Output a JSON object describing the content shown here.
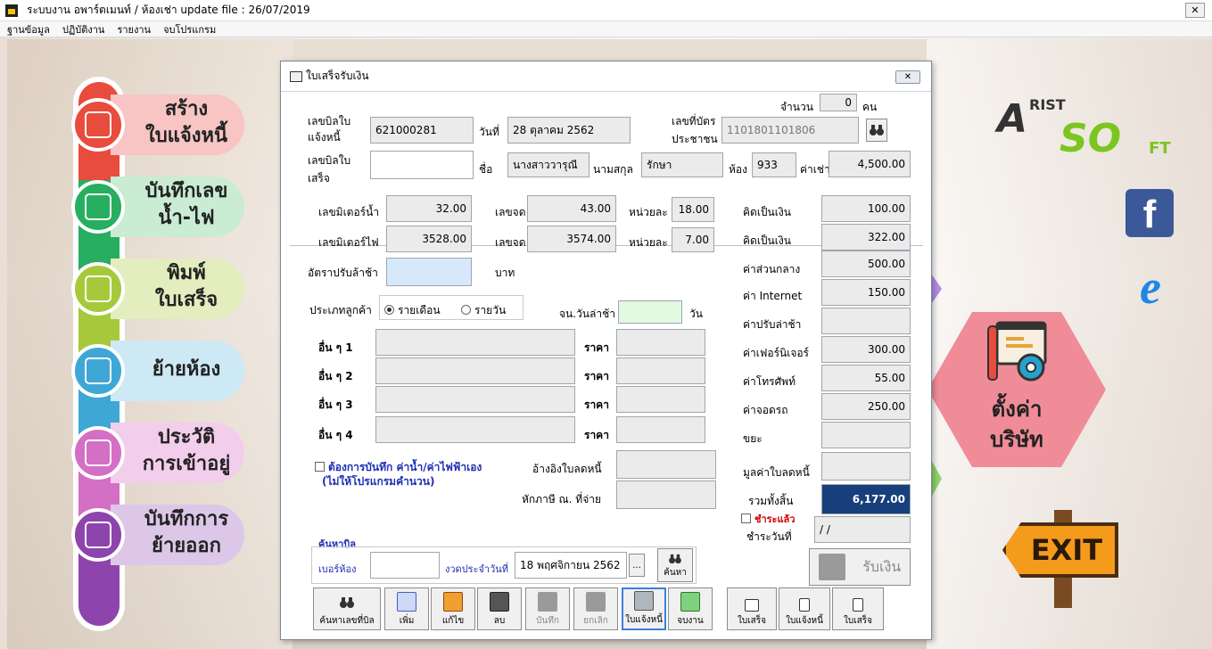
{
  "window": {
    "title": "ระบบงาน อพาร์ตเมนท์ / ห้องเช่า update file : 26/07/2019",
    "close_label": "✕"
  },
  "menu": [
    "ฐานข้อมูล",
    "ปฏิบัติงาน",
    "รายงาน",
    "จบโปรแกรม"
  ],
  "left_menu": [
    {
      "label1": "สร้าง",
      "label2": "ใบแจ้งหนี้",
      "color": "#e74c3c",
      "pill": "#f8c4c4"
    },
    {
      "label1": "บันทึกเลข",
      "label2": "น้ำ-ไฟ",
      "color": "#27ae60",
      "pill": "#c9ecd3"
    },
    {
      "label1": "พิมพ์",
      "label2": "ใบเสร็จ",
      "color": "#a6c93b",
      "pill": "#e3edbd"
    },
    {
      "label1": "ย้ายห้อง",
      "label2": "",
      "color": "#3fa7d6",
      "pill": "#cde9f5"
    },
    {
      "label1": "ประวัติ",
      "label2": "การเข้าอยู่",
      "color": "#d36fc4",
      "pill": "#f3cdec"
    },
    {
      "label1": "บันทึกการ",
      "label2": "ย้ายออก",
      "color": "#8e44ad",
      "pill": "#dcc7e8"
    }
  ],
  "right": {
    "settings_line1": "ตั้งค่า",
    "settings_line2": "บริษัท",
    "exit_label": "EXIT",
    "fb": "f",
    "ie": "e"
  },
  "logo": {
    "a": "A",
    "rist": "RIST",
    "soft": "SO",
    "ft": "FT"
  },
  "dialog": {
    "title": "ใบเสร็จรับเงิน",
    "close": "✕",
    "count_label": "จำนวน",
    "count_value": "0",
    "count_unit": "คน",
    "invoice_no_label1": "เลขบิลใบ",
    "invoice_no_label2": "แจ้งหนี้",
    "invoice_no": "621000281",
    "date_label": "วันที่",
    "date_value": "28 ตุลาคม 2562",
    "id_card_label1": "เลขที่บัตร",
    "id_card_label2": "ประชาชน",
    "id_card": "1101801101806",
    "receipt_no_label1": "เลขบิลใบ",
    "receipt_no_label2": "เสร็จ",
    "receipt_no": "",
    "first_name_label": "ชื่อ",
    "first_name": "นางสาววารุณี",
    "last_name_label": "นามสกุล",
    "last_name": "รักษา",
    "room_label": "ห้อง",
    "room": "933",
    "rent_label": "ค่าเช่า",
    "rent": "4,500.00",
    "water_meter_label": "เลขมิเตอร์น้ำ",
    "water_meter": "32.00",
    "water_read_label": "เลขจด",
    "water_read": "43.00",
    "water_unit_label": "หน่วยละ",
    "water_unit": "18.00",
    "water_amount_label": "คิดเป็นเงิน",
    "water_amount": "100.00",
    "elec_meter_label": "เลขมิเตอร์ไฟ",
    "elec_meter": "3528.00",
    "elec_read_label": "เลขจด",
    "elec_read": "3574.00",
    "elec_unit_label": "หน่วยละ",
    "elec_unit": "7.00",
    "elec_amount_label": "คิดเป็นเงิน",
    "elec_amount": "322.00",
    "late_rate_label": "อัตราปรับล้าช้า",
    "late_rate": "",
    "baht": "บาท",
    "common_label": "ค่าส่วนกลาง",
    "common": "500.00",
    "internet_label": "ค่า Internet",
    "internet": "150.00",
    "customer_type_label": "ประเภทลูกค้า",
    "monthly": "รายเดือน",
    "daily": "รายวัน",
    "late_days_label": "จน.วันล่าช้า",
    "late_days": "",
    "days_unit": "วัน",
    "late_fee_label": "ค่าปรับล่าช้า",
    "late_fee": "",
    "other_label_1": "อื่น ๆ 1",
    "other_label_2": "อื่น ๆ 2",
    "other_label_3": "อื่น ๆ 3",
    "other_label_4": "อื่น ๆ 4",
    "price_label": "ราคา",
    "furniture_label": "ค่าเฟอร์นิเจอร์",
    "furniture": "300.00",
    "phone_label": "ค่าโทรศัพท์",
    "phone": "55.00",
    "parking_label": "ค่าจอดรถ",
    "parking": "250.00",
    "garbage_label": "ขยะ",
    "garbage": "",
    "manual_label1": "ต้องการบันทึก ค่าน้ำ/ค่าไฟฟ้าเอง",
    "manual_label2": "(ไม่ให้โปรแกรมคำนวน)",
    "ref_discount_label": "อ้างอิงใบลดหนี้",
    "ref_discount": "",
    "withholding_label": "หักภาษี ณ. ที่จ่าย",
    "withholding": "",
    "discount_value_label": "มูลค่าใบลดหนี้",
    "discount_value": "",
    "total_label": "รวมทั้งสิ้น",
    "total": "6,177.00",
    "paid_label": "ชำระแล้ว",
    "paid_date_label": "ชำระวันที่",
    "paid_date": "/ /",
    "search_bill_label": "ค้นหาบิล",
    "search_room_label": "เบอร์ห้อง",
    "search_room": "",
    "search_period_label": "งวดประจำวันที่",
    "search_period": "18 พฤศจิกายน 2562",
    "ellipsis": "...",
    "search_btn": "ค้นหา",
    "receive_btn": "รับเงิน",
    "buttons": {
      "search_bill_no": "ค้นหาเลขที่บิล",
      "add": "เพิ่ม",
      "edit": "แก้ไข",
      "delete": "ลบ",
      "save": "บันทึก",
      "cancel": "ยกเลิก",
      "invoice": "ใบแจ้งหนี้",
      "exit": "จบงาน",
      "print_receipt": "ใบเสร็จ",
      "print_invoice": "ใบแจ้งหนี้",
      "print_receipt2": "ใบเสร็จ"
    }
  }
}
